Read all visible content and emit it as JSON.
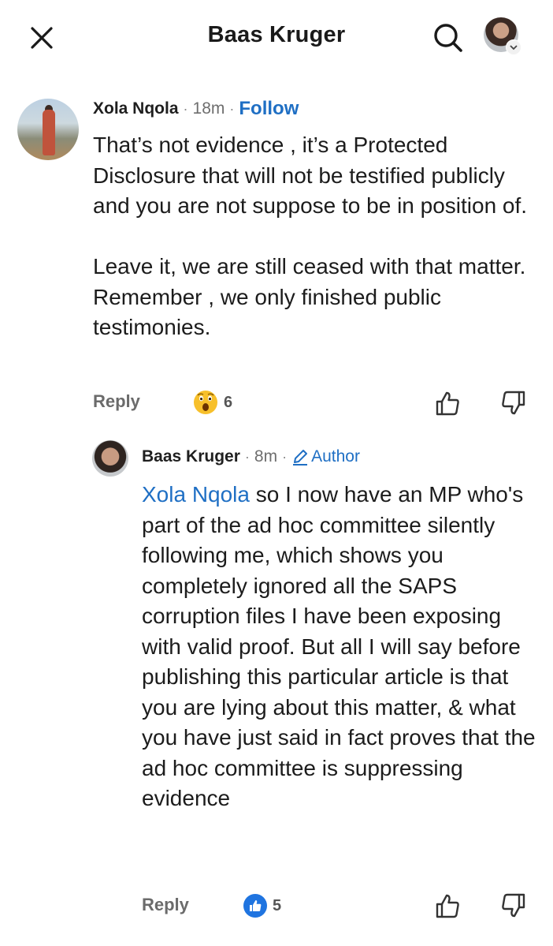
{
  "header": {
    "title": "Baas Kruger",
    "close_icon": "close-icon",
    "search_icon": "search-icon"
  },
  "comments": [
    {
      "author": "Xola Nqola",
      "time": "18m",
      "follow_label": "Follow",
      "text": "That’s not evidence , it’s a Protected Disclosure that will not be testified publicly and you are not suppose to be in position of.\n\nLeave it, we are still ceased with that matter. Remember , we only finished public testimonies.",
      "reply_label": "Reply",
      "reaction_icon": "wow-emoji-icon",
      "reaction_count": "6"
    },
    {
      "author": "Baas Kruger",
      "time": "8m",
      "author_badge": "Author",
      "mention": "Xola Nqola",
      "text": " so I now have an MP who's part of the ad hoc committee silently following me, which shows you completely ignored all the SAPS corruption files I have been exposing with valid proof. But all I will say before publishing this particular article is that you are lying about this matter, & what you have just said in fact proves that the ad hoc committee is suppressing evidence",
      "reply_label": "Reply",
      "reaction_icon": "like-icon",
      "reaction_count": "5"
    }
  ],
  "colors": {
    "link_blue": "#1f6fc4",
    "meta_gray": "#6e6e6e"
  }
}
